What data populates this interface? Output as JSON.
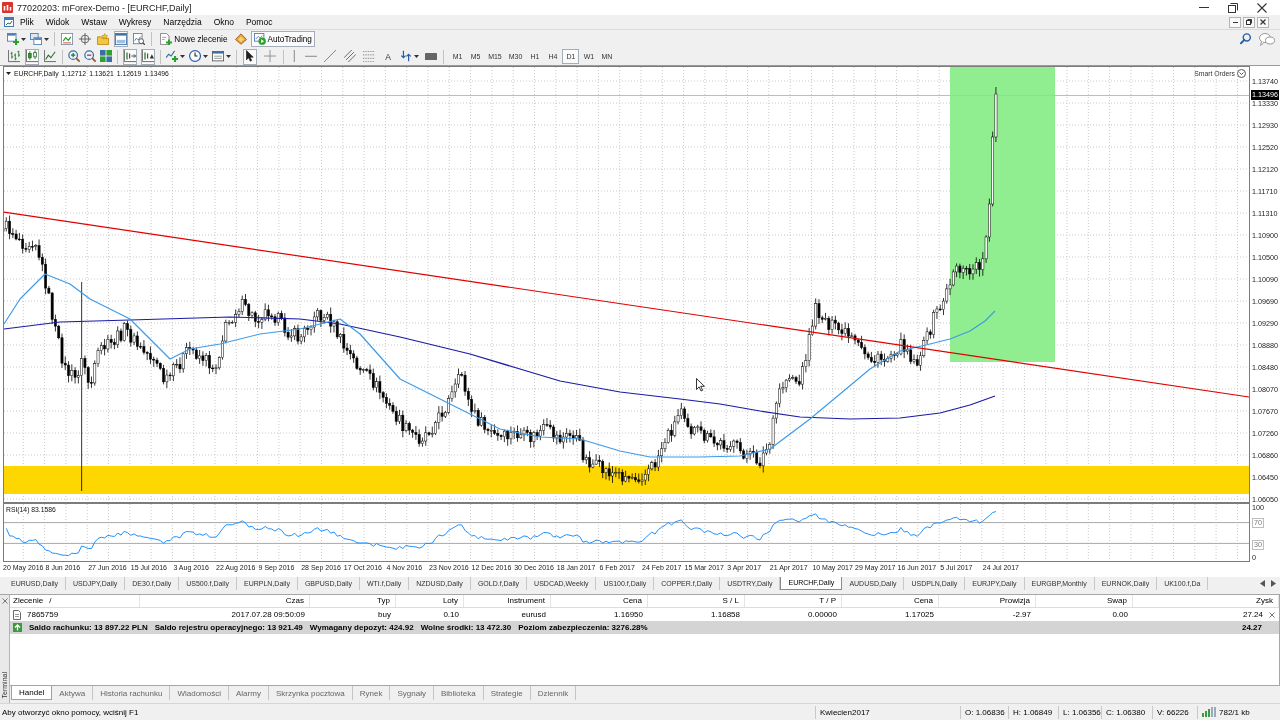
{
  "window": {
    "title": "77020203: mForex-Demo - [EURCHF,Daily]"
  },
  "menu": [
    "Plik",
    "Widok",
    "Wstaw",
    "Wykresy",
    "Narzędzia",
    "Okno",
    "Pomoc"
  ],
  "toolbar_1": {
    "panel_toggles": [
      {
        "on": false
      },
      {
        "on": false
      },
      {
        "on": false
      },
      {
        "on": true
      },
      {
        "on": false
      }
    ],
    "new_order": "Nowe zlecenie",
    "autotrading": {
      "label": "AutoTrading",
      "on": true
    }
  },
  "toolbar_2": {
    "chart_types": [
      {
        "selected": false
      },
      {
        "selected": true
      },
      {
        "selected": false
      }
    ],
    "chart_shift": {
      "on": true
    },
    "auto_scroll": {
      "on": true
    },
    "pointer_tools": [
      {
        "selected": true
      },
      {
        "selected": false
      }
    ],
    "text_tool": "A",
    "timeframes": [
      {
        "label": "M1",
        "selected": false
      },
      {
        "label": "M5",
        "selected": false
      },
      {
        "label": "M15",
        "selected": false
      },
      {
        "label": "M30",
        "selected": false
      },
      {
        "label": "H1",
        "selected": false
      },
      {
        "label": "H4",
        "selected": false
      },
      {
        "label": "D1",
        "selected": true
      },
      {
        "label": "W1",
        "selected": false
      },
      {
        "label": "MN",
        "selected": false
      }
    ]
  },
  "chart": {
    "symbol": "EURCHF,Daily",
    "ohlc": [
      "1.12712",
      "1.13621",
      "1.12619",
      "1.13496"
    ],
    "smart_orders": "Smart Orders",
    "price_ticks": [
      "1.13740",
      "1.13330",
      "1.12930",
      "1.12520",
      "1.12120",
      "1.11710",
      "1.11310",
      "1.10900",
      "1.10500",
      "1.10090",
      "1.09690",
      "1.09290",
      "1.08880",
      "1.08480",
      "1.08070",
      "1.07670",
      "1.07260",
      "1.06860",
      "1.06450",
      "1.06050"
    ],
    "current_price": "1.13496",
    "indicator": {
      "label": "RSI(14) 83.1586",
      "ticks": [
        "100",
        "70",
        "30",
        "0"
      ]
    },
    "dates": [
      "20 May 2016",
      "8 Jun 2016",
      "27 Jun 2016",
      "15 Jul 2016",
      "3 Aug 2016",
      "22 Aug 2016",
      "9 Sep 2016",
      "28 Sep 2016",
      "17 Oct 2016",
      "4 Nov 2016",
      "23 Nov 2016",
      "12 Dec 2016",
      "30 Dec 2016",
      "18 Jan 2017",
      "6 Feb 2017",
      "24 Feb 2017",
      "15 Mar 2017",
      "3 Apr 2017",
      "21 Apr 2017",
      "10 May 2017",
      "29 May 2017",
      "16 Jun 2017",
      "5 Jul 2017",
      "24 Jul 2017"
    ]
  },
  "chart_tabs": [
    {
      "label": "EURUSD,Daily",
      "selected": false
    },
    {
      "label": "USDJPY,Daily",
      "selected": false
    },
    {
      "label": "DE30.f,Daily",
      "selected": false
    },
    {
      "label": "US500.f,Daily",
      "selected": false
    },
    {
      "label": "EURPLN,Daily",
      "selected": false
    },
    {
      "label": "GBPUSD,Daily",
      "selected": false
    },
    {
      "label": "WTI.f,Daily",
      "selected": false
    },
    {
      "label": "NZDUSD,Daily",
      "selected": false
    },
    {
      "label": "GOLD.f,Daily",
      "selected": false
    },
    {
      "label": "USDCAD,Weekly",
      "selected": false
    },
    {
      "label": "US100.f,Daily",
      "selected": false
    },
    {
      "label": "COPPER.f,Daily",
      "selected": false
    },
    {
      "label": "USDTRY,Daily",
      "selected": false
    },
    {
      "label": "EURCHF,Daily",
      "selected": true
    },
    {
      "label": "AUDUSD,Daily",
      "selected": false
    },
    {
      "label": "USDPLN,Daily",
      "selected": false
    },
    {
      "label": "EURJPY,Daily",
      "selected": false
    },
    {
      "label": "EURGBP,Monthly",
      "selected": false
    },
    {
      "label": "EURNOK,Daily",
      "selected": false
    },
    {
      "label": "UK100.f,Da",
      "selected": false
    }
  ],
  "terminal": {
    "title": "Terminal",
    "columns": [
      "Zlecenie",
      "Czas",
      "Typ",
      "Loty",
      "Instrument",
      "Cena",
      "S / L",
      "T / P",
      "Cena",
      "Prowizja",
      "Swap",
      "Zysk"
    ],
    "sort_mark": "/",
    "orders": [
      {
        "cells": [
          "7865759",
          "2017.07.28 09:50:09",
          "buy",
          "0.10",
          "eurusd",
          "1.16950",
          "1.16858",
          "0.00000",
          "1.17025",
          "-2.97",
          "0.00",
          "27.24"
        ]
      }
    ],
    "summary": [
      "Saldo rachunku: 13 897.22 PLN",
      "Saldo rejestru operacyjnego: 13 921.49",
      "Wymagany depozyt: 424.92",
      "Wolne środki: 13 472.30",
      "Poziom zabezpieczenia: 3276.28%"
    ],
    "summary_total": "24.27",
    "tabs": [
      {
        "label": "Handel",
        "selected": true
      },
      {
        "label": "Aktywa",
        "selected": false
      },
      {
        "label": "Historia rachunku",
        "selected": false
      },
      {
        "label": "Wiadomości",
        "selected": false
      },
      {
        "label": "Alarmy",
        "selected": false
      },
      {
        "label": "Skrzynka pocztowa",
        "selected": false
      },
      {
        "label": "Rynek",
        "selected": false
      },
      {
        "label": "Sygnały",
        "selected": false
      },
      {
        "label": "Biblioteka",
        "selected": false
      },
      {
        "label": "Strategie",
        "selected": false
      },
      {
        "label": "Dziennik",
        "selected": false
      }
    ]
  },
  "status_bar": {
    "hint": "Aby otworzyć okno pomocy, wciśnij F1",
    "profile": "Kwiecien2017",
    "prices": [
      "O: 1.06836",
      "H: 1.06849",
      "L: 1.06356",
      "C: 1.06380",
      "V: 66226"
    ],
    "traffic": "782/1 kb"
  }
}
